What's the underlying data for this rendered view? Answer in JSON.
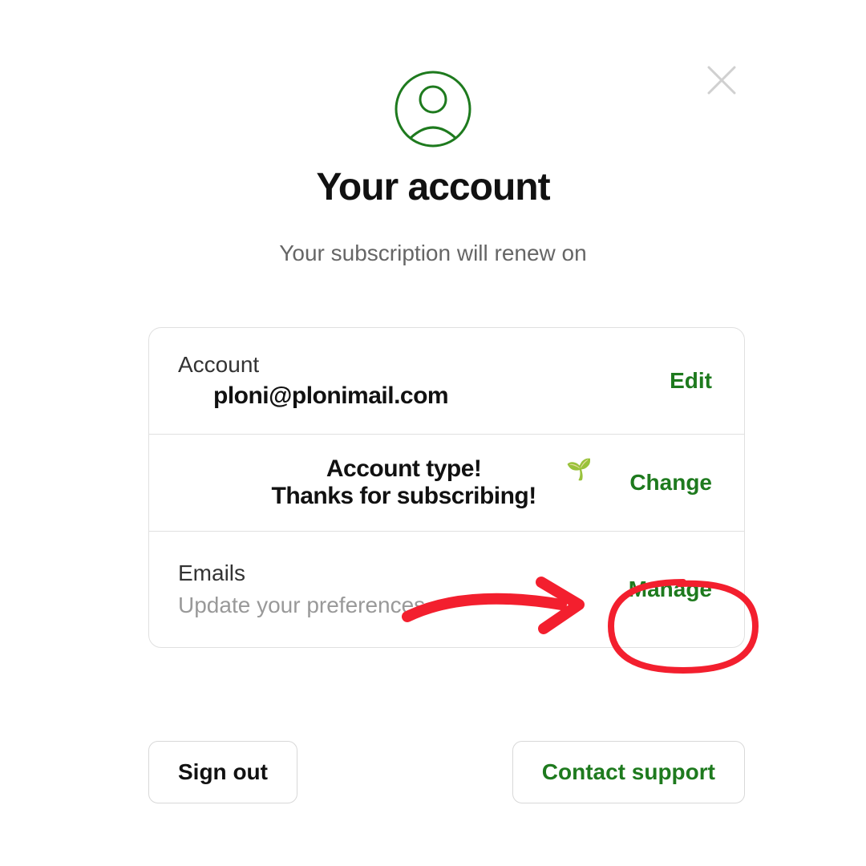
{
  "header": {
    "title": "Your account",
    "subtitle": "Your subscription will renew on"
  },
  "card": {
    "account": {
      "label": "Account",
      "email": "ploni@plonimail.com",
      "action": "Edit"
    },
    "plan": {
      "line1": "Account type!",
      "line2": "Thanks for subscribing!",
      "seedling": "🌱",
      "action": "Change"
    },
    "emails": {
      "label": "Emails",
      "sub": "Update your preferences",
      "action": "Manage"
    }
  },
  "footer": {
    "signout": "Sign out",
    "contact": "Contact support"
  },
  "icons": {
    "close": "close-icon",
    "avatar": "user-avatar-icon",
    "seedling": "seedling-icon"
  },
  "colors": {
    "accent": "#1e7a1e",
    "annotation": "#f31f2e"
  }
}
